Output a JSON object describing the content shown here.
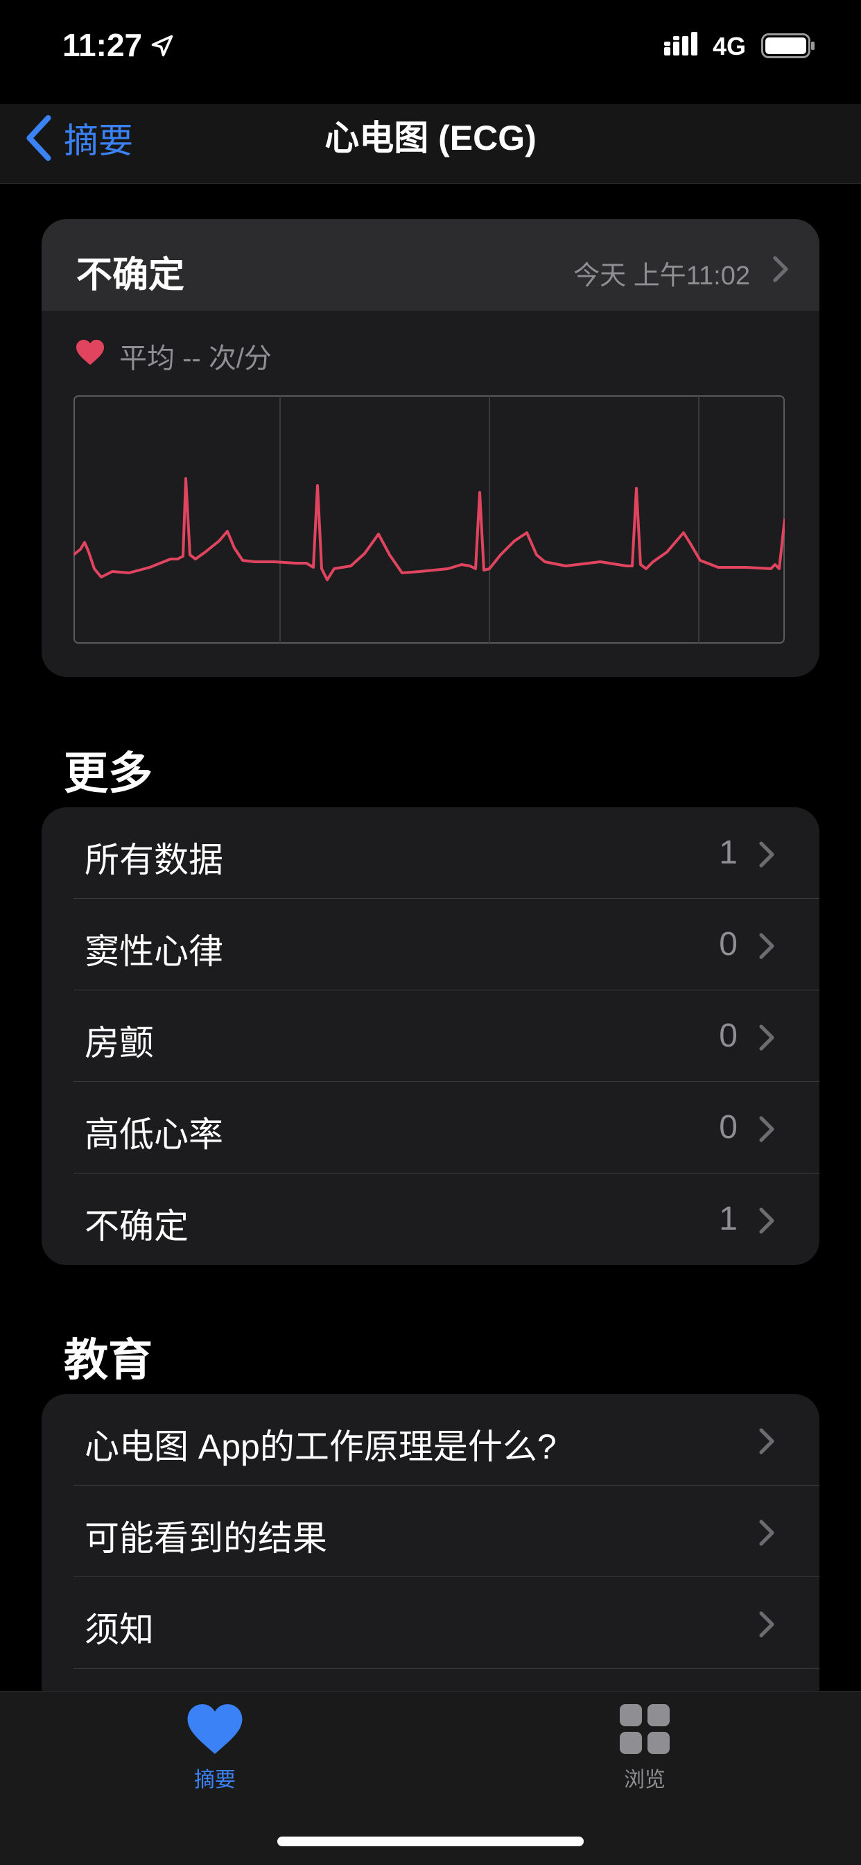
{
  "status_bar": {
    "time": "11:27",
    "network": "4G",
    "icons": [
      "location-arrow-icon",
      "signal-icon",
      "battery-icon"
    ]
  },
  "nav": {
    "back_label": "摘要",
    "title": "心电图 (ECG)"
  },
  "ecg_card": {
    "classification": "不确定",
    "date": "今天 上午11:02",
    "avg_label": "平均 -- 次/分",
    "icon": "heart-icon",
    "waveform_color": "#e0445f"
  },
  "more": {
    "title": "更多",
    "rows": [
      {
        "label": "所有数据",
        "count": "1"
      },
      {
        "label": "窦性心律",
        "count": "0"
      },
      {
        "label": "房颤",
        "count": "0"
      },
      {
        "label": "高低心率",
        "count": "0"
      },
      {
        "label": "不确定",
        "count": "1"
      }
    ]
  },
  "education": {
    "title": "教育",
    "rows": [
      {
        "label": "心电图 App的工作原理是什么?"
      },
      {
        "label": "可能看到的结果"
      },
      {
        "label": "须知"
      }
    ]
  },
  "tab_bar": {
    "items": [
      {
        "label": "摘要",
        "icon": "heart-icon",
        "active": true
      },
      {
        "label": "浏览",
        "icon": "grid-icon",
        "active": false
      }
    ],
    "active_color": "#3b82f6",
    "inactive_color": "#8e8e93"
  }
}
